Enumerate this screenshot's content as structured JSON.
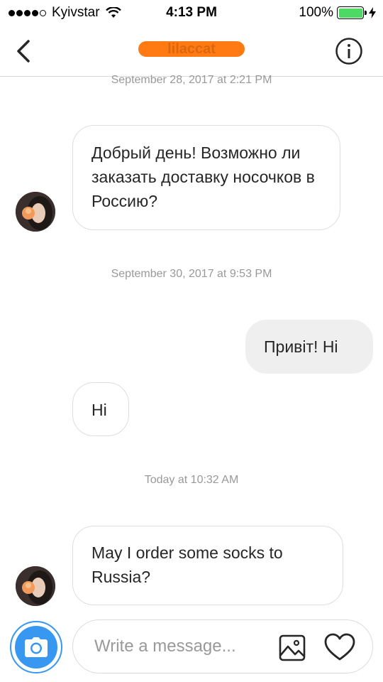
{
  "status_bar": {
    "carrier": "Kyivstar",
    "time": "4:13 PM",
    "battery": "100%"
  },
  "header": {
    "title": "lilaccat",
    "back_icon": "chevron-left-icon",
    "info_icon": "info-icon"
  },
  "messages": [
    {
      "type": "timestamp",
      "text": "September 28, 2017 at 2:21 PM"
    },
    {
      "type": "incoming",
      "text": "Добрый день! Возможно ли заказать доставку носочков в Россию?"
    },
    {
      "type": "timestamp",
      "text": "September 30, 2017 at 9:53 PM"
    },
    {
      "type": "outgoing",
      "text": "Привіт! Hi"
    },
    {
      "type": "incoming",
      "text": "Hi"
    },
    {
      "type": "timestamp",
      "text": "Today at 10:32 AM"
    },
    {
      "type": "incoming",
      "text": "May I order some socks to Russia?"
    }
  ],
  "composer": {
    "placeholder": "Write a message...",
    "camera_icon": "camera-icon",
    "gallery_icon": "gallery-icon",
    "like_icon": "heart-icon"
  },
  "colors": {
    "accent": "#3897f0",
    "battery": "#4cd964",
    "redaction": "#ff7a12"
  }
}
